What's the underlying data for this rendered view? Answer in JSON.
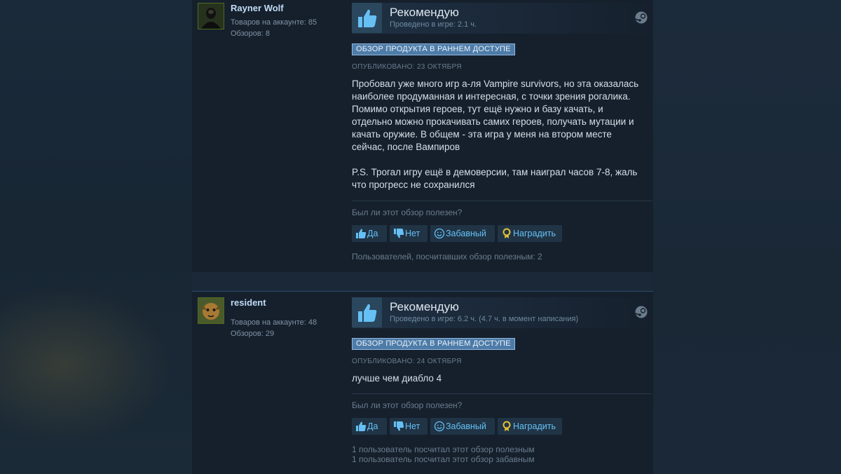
{
  "reviews": [
    {
      "author": {
        "name": "Rayner Wolf",
        "products": "Товаров на аккаунте: 85",
        "reviews": "Обзоров: 8"
      },
      "verdict": "Рекомендую",
      "hours": "Проведено в игре: 2.1 ч.",
      "early_access": "ОБЗОР ПРОДУКТА В РАННЕМ ДОСТУПЕ",
      "posted": "ОПУБЛИКОВАНО: 23 ОКТЯБРЯ",
      "body": [
        "Пробовал уже много игр а-ля Vampire survivors, но эта оказалась наиболее продуманная и интересная, с точки зрения рогалика. Помимо открытия героев, тут ещё нужно и базу качать, и отдельно можно прокачивать самих героев, получать мутации и качать оружие. В общем - эта игра у меня на втором месте сейчас, после Вампиров",
        "P.S. Трогал игру ещё в демоверсии, там наиграл часов 7-8, жаль что прогресс не сохранился"
      ],
      "helpful_question": "Был ли этот обзор полезен?",
      "buttons": {
        "yes": "Да",
        "no": "Нет",
        "funny": "Забавный",
        "award": "Наградить"
      },
      "helpful_count": [
        "Пользователей, посчитавших обзор полезным: 2"
      ]
    },
    {
      "author": {
        "name": "resident",
        "products": "Товаров на аккаунте: 48",
        "reviews": "Обзоров: 29"
      },
      "verdict": "Рекомендую",
      "hours": "Проведено в игре: 6.2 ч. (4.7 ч. в момент написания)",
      "early_access": "ОБЗОР ПРОДУКТА В РАННЕМ ДОСТУПЕ",
      "posted": "ОПУБЛИКОВАНО: 24 ОКТЯБРЯ",
      "body": [
        "лучше чем диабло 4"
      ],
      "helpful_question": "Был ли этот обзор полезен?",
      "buttons": {
        "yes": "Да",
        "no": "Нет",
        "funny": "Забавный",
        "award": "Наградить"
      },
      "helpful_count": [
        "1 пользователь посчитал этот обзор полезным",
        "1 пользователь посчитал этот обзор забавным"
      ]
    }
  ],
  "colors": {
    "link": "#66c0f4",
    "banner": "#4e7ca8",
    "panel": "#16202d",
    "page": "#1b2838"
  },
  "icons": {
    "thumbs_up": "thumbs-up-icon",
    "thumbs_down": "thumbs-down-icon",
    "smile": "smile-icon",
    "award": "award-icon",
    "steam": "steam-icon"
  }
}
